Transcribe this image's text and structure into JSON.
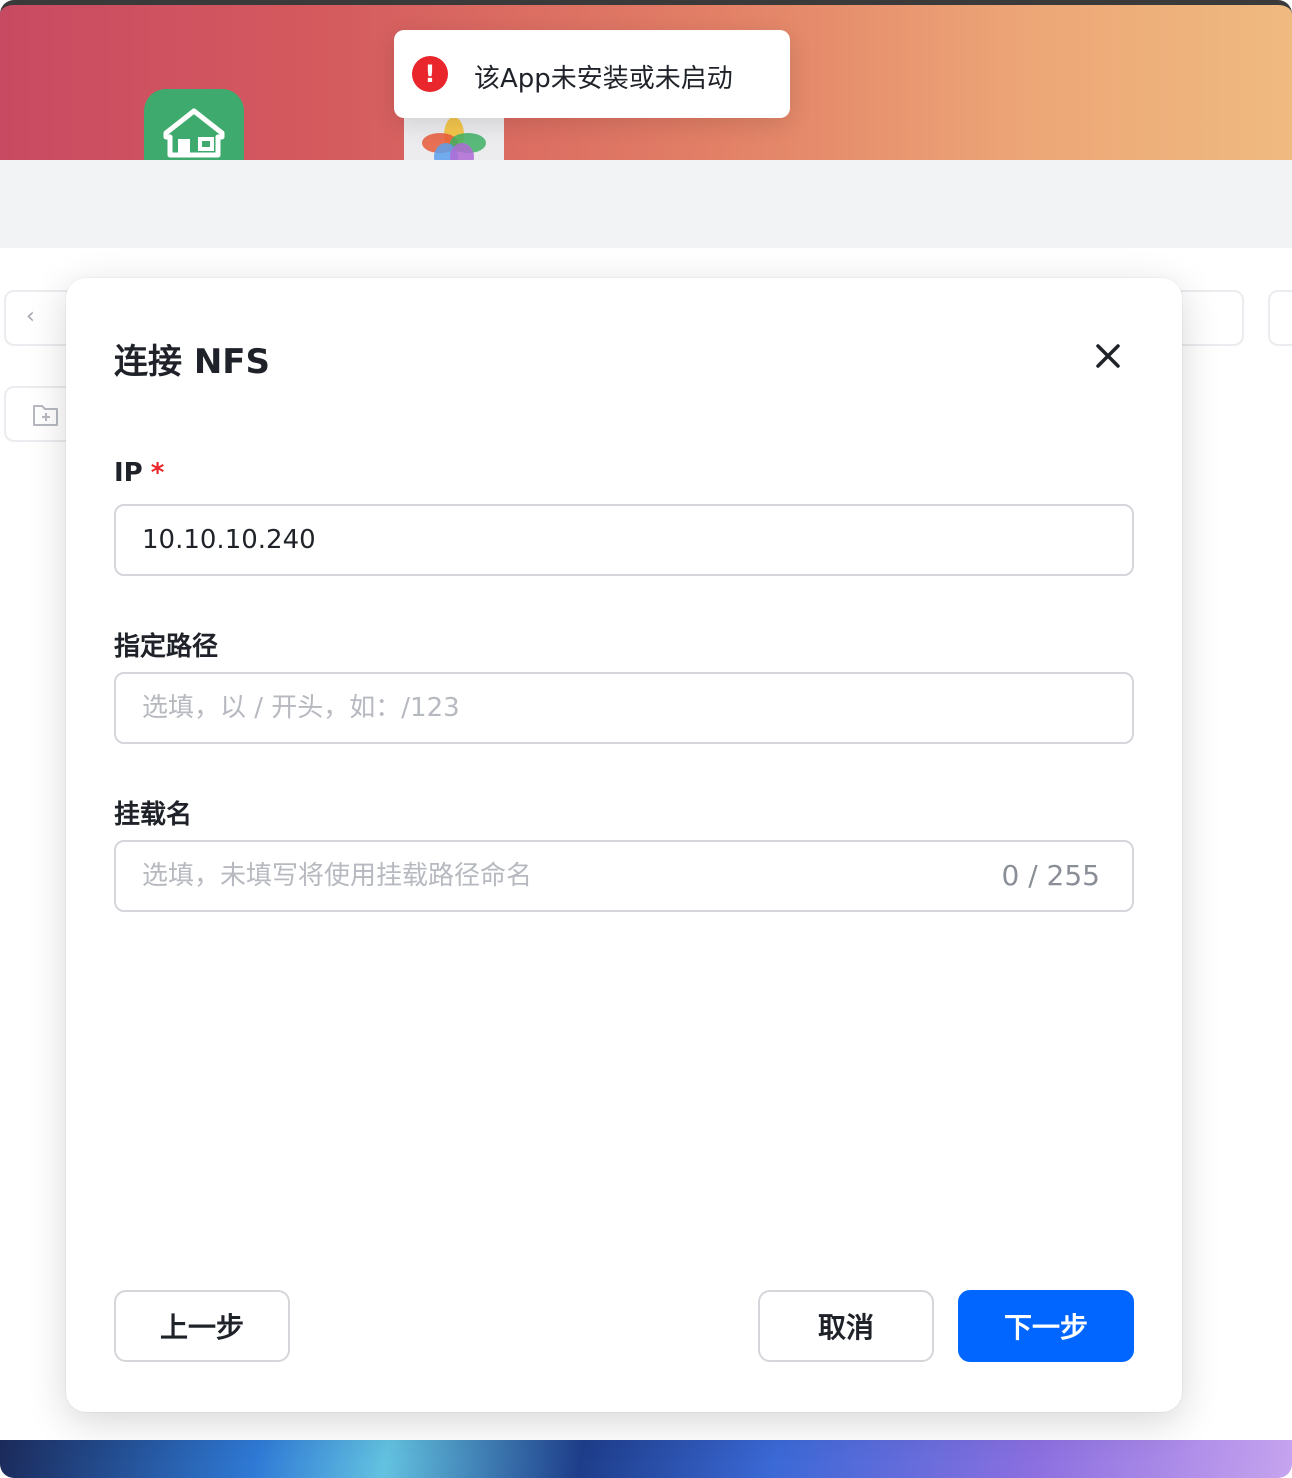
{
  "toast": {
    "message": "该App未安装或未启动",
    "icon": "error-icon",
    "color": "#e8262c"
  },
  "desktop": {
    "apps": [
      {
        "name": "edoc-app-icon"
      },
      {
        "name": "photos-app-icon"
      }
    ]
  },
  "dialog": {
    "title": "连接 NFS",
    "close_icon": "close-icon",
    "fields": {
      "ip": {
        "label": "IP",
        "required_mark": "*",
        "value": "10.10.10.240"
      },
      "path": {
        "label": "指定路径",
        "value": "",
        "placeholder": "选填，以 / 开头，如：/123"
      },
      "mount_name": {
        "label": "挂载名",
        "value": "",
        "placeholder": "选填，未填写将使用挂载路径命名",
        "counter": "0 / 255"
      }
    },
    "buttons": {
      "prev": "上一步",
      "cancel": "取消",
      "next": "下一步"
    },
    "accent_color": "#0066ff"
  }
}
